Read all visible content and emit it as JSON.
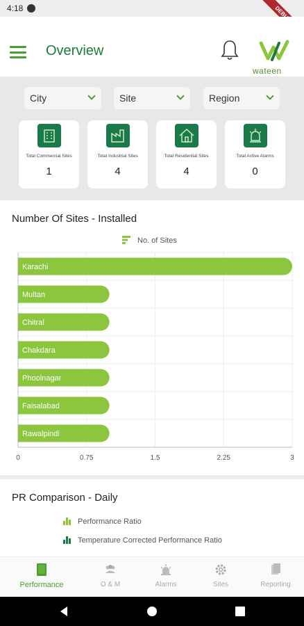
{
  "status_bar": {
    "time": "4:18"
  },
  "debug_banner": "DEBUG",
  "header": {
    "title": "Overview",
    "logo_text": "wateen"
  },
  "filters": [
    {
      "label": "City"
    },
    {
      "label": "Site"
    },
    {
      "label": "Region"
    }
  ],
  "cards": [
    {
      "label": "Total Commercial Sites",
      "value": "1",
      "icon": "commercial-building-icon"
    },
    {
      "label": "Total Industrial Sites",
      "value": "4",
      "icon": "factory-icon"
    },
    {
      "label": "Total Residential Sites",
      "value": "4",
      "icon": "house-icon"
    },
    {
      "label": "Total Active Alarms",
      "value": "0",
      "icon": "alarm-icon"
    }
  ],
  "sites_chart": {
    "title": "Number Of Sites - Installed",
    "legend": "No. of Sites"
  },
  "pr_chart": {
    "title": "PR Comparison - Daily",
    "legend": [
      "Performance Ratio",
      "Temperature Corrected Performance Ratio"
    ]
  },
  "nav": [
    {
      "label": "Performance",
      "icon": "book-icon",
      "active": true
    },
    {
      "label": "O & M",
      "icon": "people-icon",
      "active": false
    },
    {
      "label": "Alarms",
      "icon": "siren-icon",
      "active": false
    },
    {
      "label": "Sites",
      "icon": "gear-icon",
      "active": false
    },
    {
      "label": "Reporting",
      "icon": "report-icon",
      "active": false
    }
  ],
  "colors": {
    "primary": "#1c7a3c",
    "accent": "#8cc63f",
    "icon_bg": "#1a7a4a"
  },
  "chart_data": {
    "type": "bar",
    "orientation": "horizontal",
    "title": "Number Of Sites - Installed",
    "categories": [
      "Karachi",
      "Multan",
      "Chitral",
      "Chakdara",
      "Phoolnagar",
      "Faisalabad",
      "Rawalpindi"
    ],
    "series": [
      {
        "name": "No. of Sites",
        "values": [
          3,
          1,
          1,
          1,
          1,
          1,
          1
        ]
      }
    ],
    "xlim": [
      0,
      3
    ],
    "xticks": [
      "0",
      "0.75",
      "1.5",
      "2.25",
      "3"
    ],
    "grid": true,
    "legend": "top-center"
  }
}
